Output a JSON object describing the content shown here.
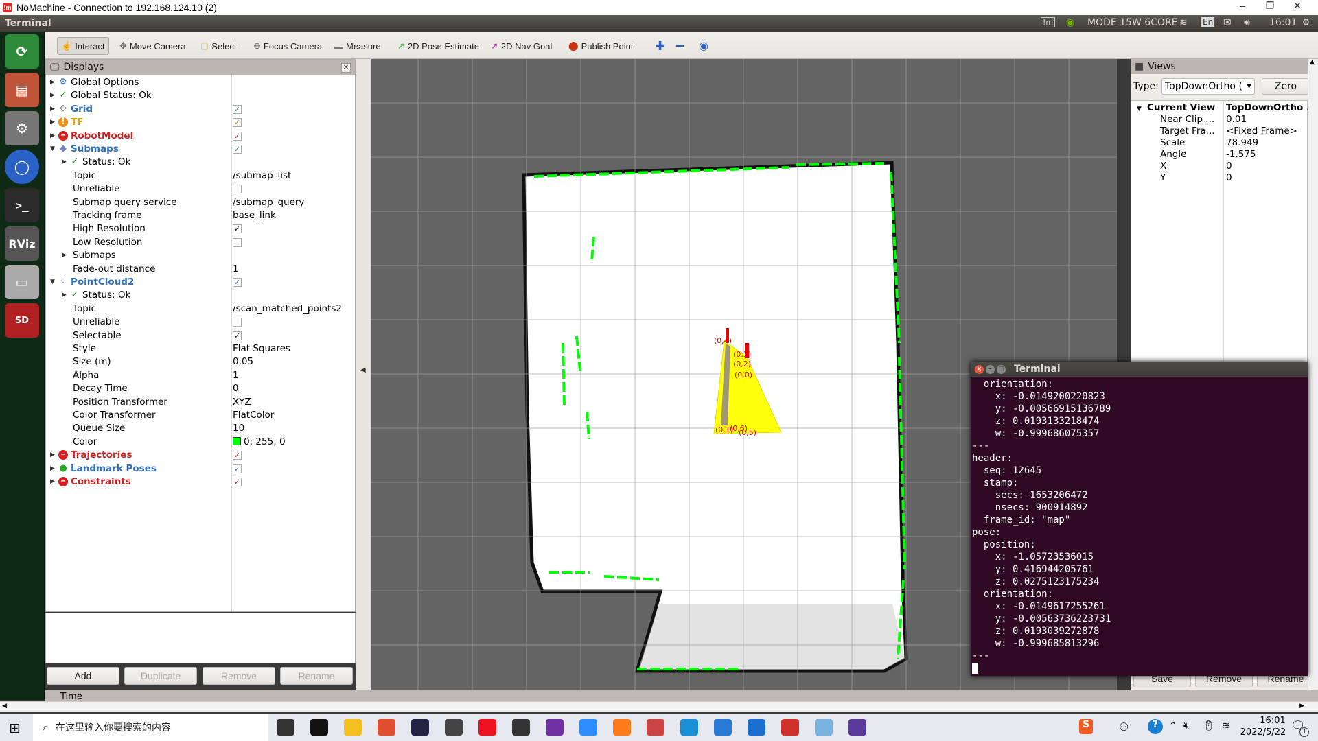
{
  "window": {
    "title": "NoMachine - Connection to 192.168.124.10 (2)",
    "logo": "!m"
  },
  "panel": {
    "app": "Terminal",
    "mode": "MODE 15W 6CORE",
    "lang": "En",
    "time": "16:01"
  },
  "launcher": [
    "ubuntu-software-icon",
    "files-icon",
    "settings-icon",
    "chromium-icon",
    "terminal-icon",
    "rviz-icon",
    "drive-icon",
    "sd-card-icon"
  ],
  "launcher_text": {
    "rviz": "RViz",
    "sd": "SD"
  },
  "toolbar": {
    "items": [
      {
        "label": "Interact",
        "icon": "hand-icon",
        "color": "#555555"
      },
      {
        "label": "Move Camera",
        "icon": "move-camera-icon",
        "color": "#666666"
      },
      {
        "label": "Select",
        "icon": "select-icon",
        "color": "#d8c36a"
      },
      {
        "label": "Focus Camera",
        "icon": "focus-camera-icon",
        "color": "#666666"
      },
      {
        "label": "Measure",
        "icon": "ruler-icon",
        "color": "#777777"
      },
      {
        "label": "2D Pose Estimate",
        "icon": "pose-arrow-icon",
        "color": "#22cc22"
      },
      {
        "label": "2D Nav Goal",
        "icon": "nav-arrow-icon",
        "color": "#dd22cc"
      },
      {
        "label": "Publish Point",
        "icon": "pin-icon",
        "color": "#cc3311"
      }
    ]
  },
  "displays": {
    "title": "Displays",
    "rows": [
      {
        "level": 0,
        "expand": "right",
        "icon": "gear-icon",
        "label": "Global Options"
      },
      {
        "level": 0,
        "expand": "right",
        "icon": "check-icon",
        "label": "Global Status: Ok"
      },
      {
        "level": 0,
        "expand": "right",
        "icon": "grid-icon",
        "label": "Grid",
        "color": "#2f6fbf",
        "bold": true,
        "check": "#2f6fbf"
      },
      {
        "level": 0,
        "expand": "right",
        "icon": "warning-icon",
        "label": "TF",
        "color": "#e0a000",
        "bold": true,
        "check": "#c08a00"
      },
      {
        "level": 0,
        "expand": "right",
        "icon": "error-icon",
        "label": "RobotModel",
        "color": "#cc2222",
        "bold": true,
        "check": "#cc2222"
      },
      {
        "level": 0,
        "expand": "down",
        "icon": "submap-icon",
        "label": "Submaps",
        "color": "#2f6fbf",
        "bold": true,
        "check": "#2f6fbf"
      },
      {
        "level": 1,
        "expand": "right",
        "icon": "check-icon",
        "label": "Status: Ok"
      },
      {
        "level": 1,
        "label": "Topic",
        "value": "/submap_list"
      },
      {
        "level": 1,
        "label": "Unreliable",
        "check": ""
      },
      {
        "level": 1,
        "label": "Submap query service",
        "value": "/submap_query"
      },
      {
        "level": 1,
        "label": "Tracking frame",
        "value": "base_link"
      },
      {
        "level": 1,
        "label": "High Resolution",
        "check": "#111111"
      },
      {
        "level": 1,
        "label": "Low Resolution",
        "check": ""
      },
      {
        "level": 1,
        "expand": "right",
        "label": "Submaps"
      },
      {
        "level": 1,
        "label": "Fade-out distance",
        "value": "1"
      },
      {
        "level": 0,
        "expand": "down",
        "icon": "pointcloud-icon",
        "label": "PointCloud2",
        "color": "#2f6fbf",
        "bold": true,
        "check": "#2f6fbf"
      },
      {
        "level": 1,
        "expand": "right",
        "icon": "check-icon",
        "label": "Status: Ok"
      },
      {
        "level": 1,
        "label": "Topic",
        "value": "/scan_matched_points2"
      },
      {
        "level": 1,
        "label": "Unreliable",
        "check": ""
      },
      {
        "level": 1,
        "label": "Selectable",
        "check": "#111111"
      },
      {
        "level": 1,
        "label": "Style",
        "value": "Flat Squares"
      },
      {
        "level": 1,
        "label": "Size (m)",
        "value": "0.05"
      },
      {
        "level": 1,
        "label": "Alpha",
        "value": "1"
      },
      {
        "level": 1,
        "label": "Decay Time",
        "value": "0"
      },
      {
        "level": 1,
        "label": "Position Transformer",
        "value": "XYZ"
      },
      {
        "level": 1,
        "label": "Color Transformer",
        "value": "FlatColor"
      },
      {
        "level": 1,
        "label": "Queue Size",
        "value": "10"
      },
      {
        "level": 1,
        "label": "Color",
        "value": "0; 255; 0",
        "swatch": "#00ff00"
      },
      {
        "level": 0,
        "expand": "right",
        "icon": "error-icon",
        "label": "Trajectories",
        "color": "#cc2222",
        "bold": true,
        "check": "#cc2222"
      },
      {
        "level": 0,
        "expand": "right",
        "icon": "landmark-icon",
        "label": "Landmark Poses",
        "color": "#2f6fbf",
        "bold": true,
        "check": "#2f6fbf"
      },
      {
        "level": 0,
        "expand": "right",
        "icon": "error-icon",
        "label": "Constraints",
        "color": "#cc2222",
        "bold": true,
        "check": "#cc2222"
      }
    ],
    "buttons": [
      {
        "label": "Add",
        "enabled": true
      },
      {
        "label": "Duplicate",
        "enabled": false
      },
      {
        "label": "Remove",
        "enabled": false
      },
      {
        "label": "Rename",
        "enabled": false
      }
    ]
  },
  "time_panel": {
    "title": "Time"
  },
  "views": {
    "title": "Views",
    "type_label": "Type:",
    "type_value": "TopDownOrtho (",
    "zero": "Zero",
    "current_view": {
      "label": "Current View",
      "value": "TopDownOrtho ."
    },
    "props": [
      {
        "k": "Near Clip ...",
        "v": "0.01"
      },
      {
        "k": "Target Fra...",
        "v": "<Fixed Frame>"
      },
      {
        "k": "Scale",
        "v": "78.949"
      },
      {
        "k": "Angle",
        "v": "-1.575"
      },
      {
        "k": "X",
        "v": "0"
      },
      {
        "k": "Y",
        "v": "0"
      }
    ],
    "buttons": [
      "Save",
      "Remove",
      "Rename"
    ]
  },
  "terminal": {
    "title": "Terminal",
    "lines": [
      "  orientation:",
      "    x: -0.0149200220823",
      "    y: -0.00566915136789",
      "    z: 0.0193133218474",
      "    w: -0.999686075357",
      "---",
      "header:",
      "  seq: 12645",
      "  stamp:",
      "    secs: 1653206472",
      "    nsecs: 900914892",
      "  frame_id: \"map\"",
      "pose:",
      "  position:",
      "    x: -1.05723536015",
      "    y: 0.416944205761",
      "    z: 0.0275123175234",
      "  orientation:",
      "    x: -0.0149617255261",
      "    y: -0.00563736223731",
      "    z: 0.0193039272878",
      "    w: -0.999685813296",
      "---"
    ]
  },
  "map": {
    "labels": [
      "(0,4)",
      "(0,3)",
      "(0,2)",
      "(0,0)",
      "(0,1)",
      "(0,6)",
      "(0,5)"
    ],
    "background": "#646464",
    "scan_color": "#00ff00",
    "trajectory_color": "#ffff00"
  },
  "taskbar": {
    "search_placeholder": "在这里输入你要搜索的内容",
    "clock_time": "16:01",
    "clock_date": "2022/5/22",
    "notifications": "1",
    "apps": [
      {
        "name": "task-view-icon",
        "color": "#333333"
      },
      {
        "name": "store-icon",
        "color": "#111111"
      },
      {
        "name": "file-explorer-icon",
        "color": "#f4c020"
      },
      {
        "name": "app-red-diamond-icon",
        "color": "#e05030"
      },
      {
        "name": "app-blue-bolt-icon",
        "color": "#222244"
      },
      {
        "name": "mail-icon",
        "color": "#444444"
      },
      {
        "name": "youdao-icon",
        "color": "#ee1122"
      },
      {
        "name": "camera-icon",
        "color": "#333333"
      },
      {
        "name": "onenote-icon",
        "color": "#7030a0"
      },
      {
        "name": "zoom-icon",
        "color": "#2d8cff"
      },
      {
        "name": "firefox-icon",
        "color": "#ff7a1a"
      },
      {
        "name": "paint-icon",
        "color": "#cc4444"
      },
      {
        "name": "edge-icon",
        "color": "#1a8fd6"
      },
      {
        "name": "app-swirl-icon",
        "color": "#2a7bd6"
      },
      {
        "name": "phone-icon",
        "color": "#1a6fd0"
      },
      {
        "name": "nomachine-icon",
        "color": "#d0302a"
      },
      {
        "name": "app-chart-icon",
        "color": "#7ab3e0"
      },
      {
        "name": "app-purple-icon",
        "color": "#5a3a9a"
      }
    ]
  }
}
